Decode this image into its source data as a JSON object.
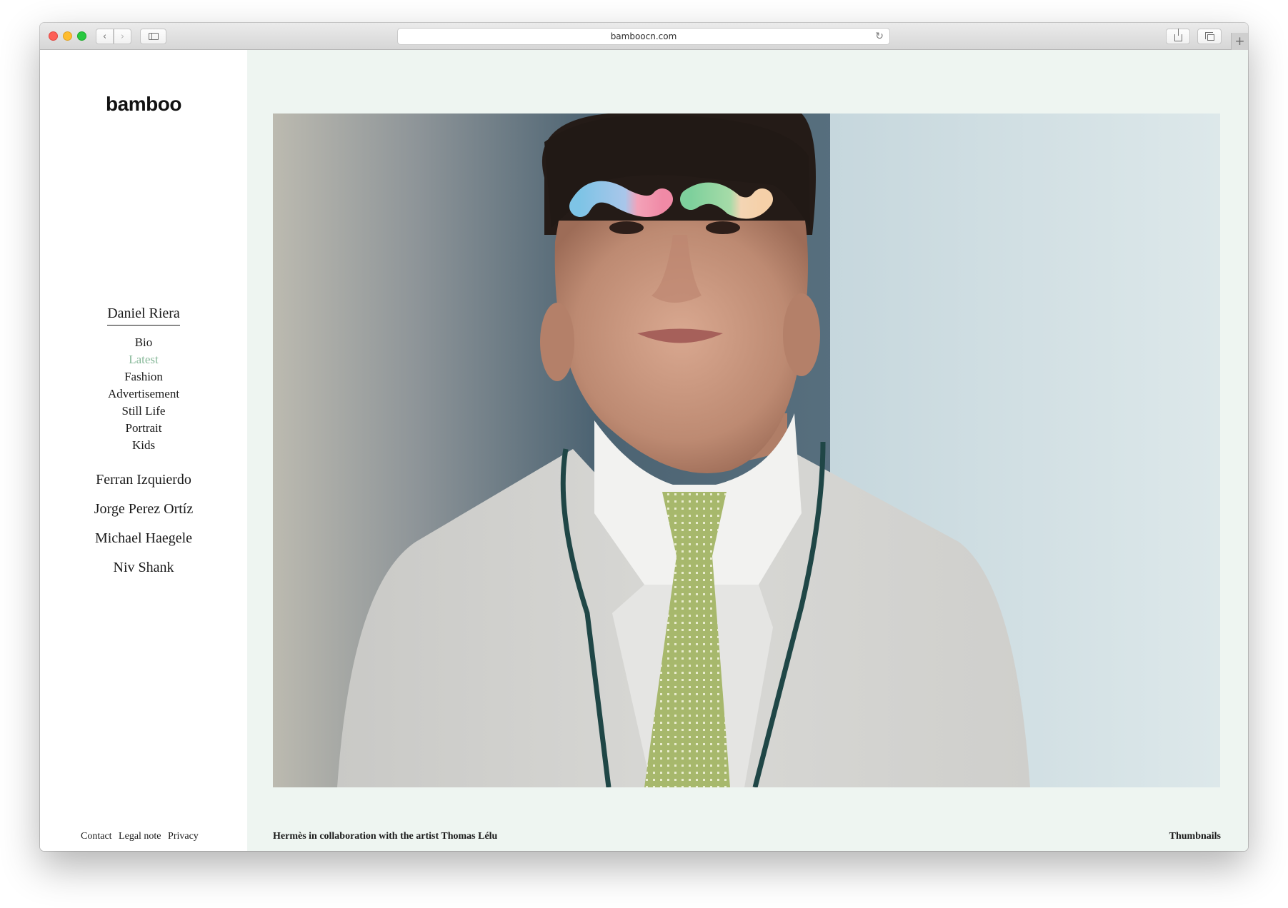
{
  "browser": {
    "url": "bamboocn.com",
    "new_tab_glyph": "+",
    "back_glyph": "‹",
    "forward_glyph": "›",
    "reload_glyph": "↻"
  },
  "site": {
    "logo": "bamboo"
  },
  "sidebar": {
    "current_artist": "Daniel Riera",
    "sections": [
      {
        "label": "Bio",
        "active": false
      },
      {
        "label": "Latest",
        "active": true
      },
      {
        "label": "Fashion",
        "active": false
      },
      {
        "label": "Advertisement",
        "active": false
      },
      {
        "label": "Still Life",
        "active": false
      },
      {
        "label": "Portrait",
        "active": false
      },
      {
        "label": "Kids",
        "active": false
      }
    ],
    "other_artists": [
      "Ferran Izquierdo",
      "Jorge Perez Ortíz",
      "Michael Haegele",
      "Niv Shank"
    ],
    "footer_links": [
      "Contact",
      "Legal note",
      "Privacy"
    ]
  },
  "main": {
    "caption": "Hermès in collaboration with the artist Thomas Lélu",
    "thumbnails_link": "Thumbnails"
  },
  "colors": {
    "active_link": "#86b898",
    "content_background": "#eef5f1"
  }
}
